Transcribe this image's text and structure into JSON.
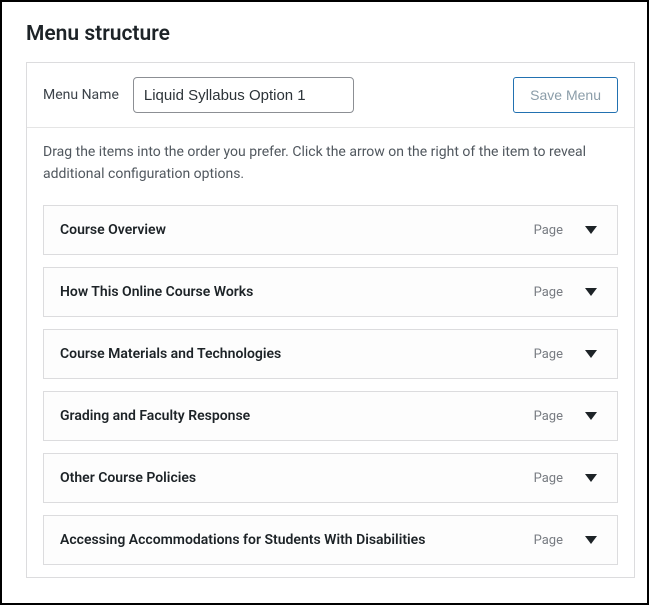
{
  "heading": "Menu structure",
  "menu_name": {
    "label": "Menu Name",
    "value": "Liquid Syllabus Option 1"
  },
  "save_button_label": "Save Menu",
  "instructions": "Drag the items into the order you prefer. Click the arrow on the right of the item to reveal additional configuration options.",
  "items": [
    {
      "title": "Course Overview",
      "type": "Page"
    },
    {
      "title": "How This Online Course Works",
      "type": "Page"
    },
    {
      "title": "Course Materials and Technologies",
      "type": "Page"
    },
    {
      "title": "Grading and Faculty Response",
      "type": "Page"
    },
    {
      "title": "Other Course Policies",
      "type": "Page"
    },
    {
      "title": "Accessing Accommodations for Students With Disabilities",
      "type": "Page"
    }
  ]
}
